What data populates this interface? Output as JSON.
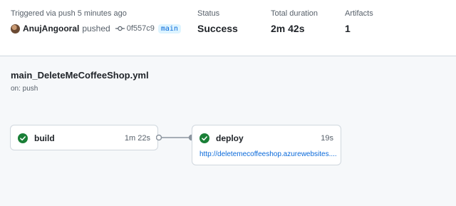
{
  "summary": {
    "triggered_text": "Triggered via push 5 minutes ago",
    "actor": "AnujAngooral",
    "action": "pushed",
    "commit_sha": "0f557c9",
    "branch": "main",
    "status_label": "Status",
    "status_value": "Success",
    "duration_label": "Total duration",
    "duration_value": "2m 42s",
    "artifacts_label": "Artifacts",
    "artifacts_value": "1"
  },
  "workflow": {
    "file": "main_DeleteMeCoffeeShop.yml",
    "trigger": "on: push"
  },
  "jobs": [
    {
      "name": "build",
      "duration": "1m 22s",
      "status": "success",
      "icon": "check-circle-icon"
    },
    {
      "name": "deploy",
      "duration": "19s",
      "status": "success",
      "icon": "check-circle-icon",
      "url": "http://deletemecoffeeshop.azurewebsites...."
    }
  ],
  "colors": {
    "success": "#1a7f37",
    "link": "#0969da",
    "border": "#d0d7de",
    "muted": "#57606a",
    "background": "#f6f8fa"
  }
}
